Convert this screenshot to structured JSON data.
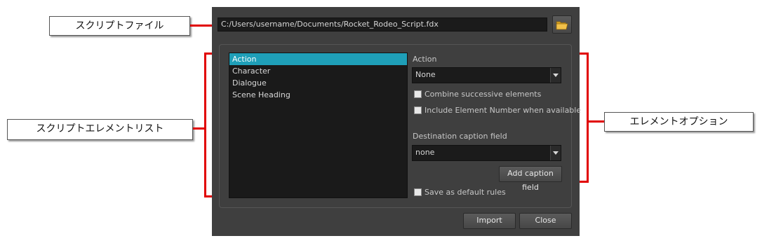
{
  "callouts": {
    "script_file": "スクリプトファイル",
    "element_list": "スクリプトエレメントリスト",
    "element_options": "エレメントオプション"
  },
  "dialog": {
    "file_path": "C:/Users/username/Documents/Rocket_Rodeo_Script.fdx",
    "browse_icon": "folder-open-icon",
    "elements": [
      "Action",
      "Character",
      "Dialogue",
      "Scene Heading"
    ],
    "selected_element": "Action",
    "options": {
      "heading": "Action",
      "action_select": "None",
      "combine_label": "Combine successive elements",
      "combine_checked": false,
      "include_number_label": "Include Element Number when available",
      "include_number_checked": false,
      "destination_label": "Destination caption field",
      "destination_select": "none",
      "add_caption_button": "Add caption field",
      "save_default_label": "Save as default rules",
      "save_default_checked": false
    },
    "import_button": "Import",
    "close_button": "Close"
  },
  "colors": {
    "dialog_bg": "#3f3f3f",
    "selection": "#1f9fb8",
    "callout_line": "#e10000"
  }
}
